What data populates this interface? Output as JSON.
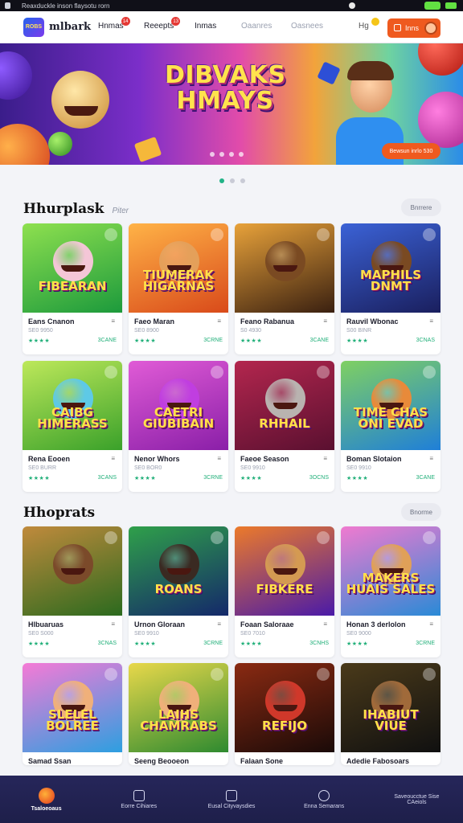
{
  "statusbar": {
    "url": "Reaxduckle inson flaysotu rorn"
  },
  "nav": {
    "logo_text": "ROBS",
    "brand": "mlbark",
    "items": [
      {
        "label": "Hnmas",
        "badge": "14"
      },
      {
        "label": "Reeepts",
        "badge": "13"
      },
      {
        "label": "Inmas",
        "badge": ""
      },
      {
        "label": "Oaanres",
        "badge": ""
      },
      {
        "label": "Oasnees",
        "badge": ""
      }
    ],
    "lang": "Hg",
    "login_label": "Inns"
  },
  "hero": {
    "title_line1": "DIBVAKS",
    "title_line2": "HMAYS",
    "cta": "Bewsun inrlo 530"
  },
  "section1": {
    "title": "Hhurplask",
    "subtitle": "Piter",
    "more": "Bnrrere",
    "cards": [
      {
        "thumb_text": "FIBEARAN",
        "name": "Eans Cnanon",
        "sub": "SE0 9950",
        "stars": "★★★★",
        "players": "3CANE",
        "c1": "#1c9a3c",
        "c2": "#8ee04f",
        "char": "#f4c6d7"
      },
      {
        "thumb_text": "TIUMERAK HIGARNAS",
        "name": "Faeo Maran",
        "sub": "SE0 8900",
        "stars": "★★★★",
        "players": "3CRNE",
        "c1": "#d94a1a",
        "c2": "#ffb347",
        "char": "#e4a05a"
      },
      {
        "thumb_text": "",
        "name": "Feano Rabanua",
        "sub": "S0 4930",
        "stars": "★★★★",
        "players": "3CANE",
        "c1": "#3a2010",
        "c2": "#e8a23a",
        "char": "#7a4a22"
      },
      {
        "thumb_text": "MAPHILS DNMT",
        "name": "Rauvil Wbonac",
        "sub": "S00 BINR",
        "stars": "★★★★",
        "players": "3CNAS",
        "c1": "#1a1f5e",
        "c2": "#3b62d6",
        "char": "#7a4a22"
      },
      {
        "thumb_text": "CAIBG HIMERASS",
        "name": "Rena Eooen",
        "sub": "SE0 BURR",
        "stars": "★★★★",
        "players": "3CANS",
        "c1": "#3aa12a",
        "c2": "#bde85a",
        "char": "#5ec9e6"
      },
      {
        "thumb_text": "CAETRI GIUBIBAIN",
        "name": "Nenor Whors",
        "sub": "SE0 BOR0",
        "stars": "★★★★",
        "players": "3CRNE",
        "c1": "#8a1fa8",
        "c2": "#e05bd6",
        "char": "#c03ee0"
      },
      {
        "thumb_text": "RHHAIL",
        "name": "Faeoe Season",
        "sub": "SE0 9910",
        "stars": "★★★★",
        "players": "3OCNS",
        "c1": "#5a1030",
        "c2": "#b3264e",
        "char": "#b9b3b0"
      },
      {
        "thumb_text": "TIME CHAS ONI EVAD",
        "name": "Boman Slotaion",
        "sub": "SE0 9910",
        "stars": "★★★★",
        "players": "3CANE",
        "c1": "#1f7fd8",
        "c2": "#7fd062",
        "char": "#e88a3a"
      }
    ]
  },
  "section2": {
    "title": "Hhoprats",
    "more": "Bnorme",
    "cards": [
      {
        "thumb_text": "",
        "name": "Hlbuaruas",
        "sub": "SE0 S000",
        "stars": "★★★★",
        "players": "3CNAS",
        "c1": "#2b6a1e",
        "c2": "#c08a3c",
        "char": "#7b4a2a"
      },
      {
        "thumb_text": "ROANS",
        "name": "Urnon Gloraan",
        "sub": "SE0 9910",
        "stars": "★★★★",
        "players": "3CRNE",
        "c1": "#14286a",
        "c2": "#2fa04a",
        "char": "#3a2a22"
      },
      {
        "thumb_text": "FIBKERE",
        "name": "Foaan Saloraae",
        "sub": "SE0 7010",
        "stars": "★★★★",
        "players": "3CNHS",
        "c1": "#4a1aa8",
        "c2": "#ec7a2a",
        "char": "#d49a52"
      },
      {
        "thumb_text": "MAKERS HUAIS SALES",
        "name": "Honan 3 derlolon",
        "sub": "SE0 9000",
        "stars": "★★★★",
        "players": "3CRNE",
        "c1": "#2a8ad6",
        "c2": "#f07ad0",
        "char": "#e0a058"
      },
      {
        "thumb_text": "SLELEL BOLREE",
        "name": "Samad Ssan",
        "sub": "",
        "stars": "",
        "players": "",
        "c1": "#2d9fe0",
        "c2": "#f57ad6",
        "char": "#f0b07a"
      },
      {
        "thumb_text": "LAIHS CHAMRABS",
        "name": "Seeng Beooeon",
        "sub": "",
        "stars": "",
        "players": "",
        "c1": "#2e8a30",
        "c2": "#e8d84a",
        "char": "#f0b07a"
      },
      {
        "thumb_text": "REFIJO",
        "name": "Falaan Sone",
        "sub": "",
        "stars": "",
        "players": "",
        "c1": "#1a0a08",
        "c2": "#8a2a12",
        "char": "#d0382a"
      },
      {
        "thumb_text": "IHABIUT VIUE",
        "name": "Adedie Fabosoars",
        "sub": "",
        "stars": "",
        "players": "",
        "c1": "#101010",
        "c2": "#4a3a1a",
        "char": "#a06a3a"
      }
    ]
  },
  "bottom_nav": [
    {
      "label": "Tsaloeoaus",
      "active": true
    },
    {
      "label": "Eorre Cihiares",
      "active": false
    },
    {
      "label": "Eusal Cityvaysdies",
      "active": false
    },
    {
      "label": "Enna Semarans",
      "active": false
    },
    {
      "label": "Saveoucctue Sise CAeiols",
      "active": false
    }
  ],
  "colors": {
    "accent": "#ef5a1f",
    "nav_bg": "#26265a",
    "star": "#22b07a"
  }
}
